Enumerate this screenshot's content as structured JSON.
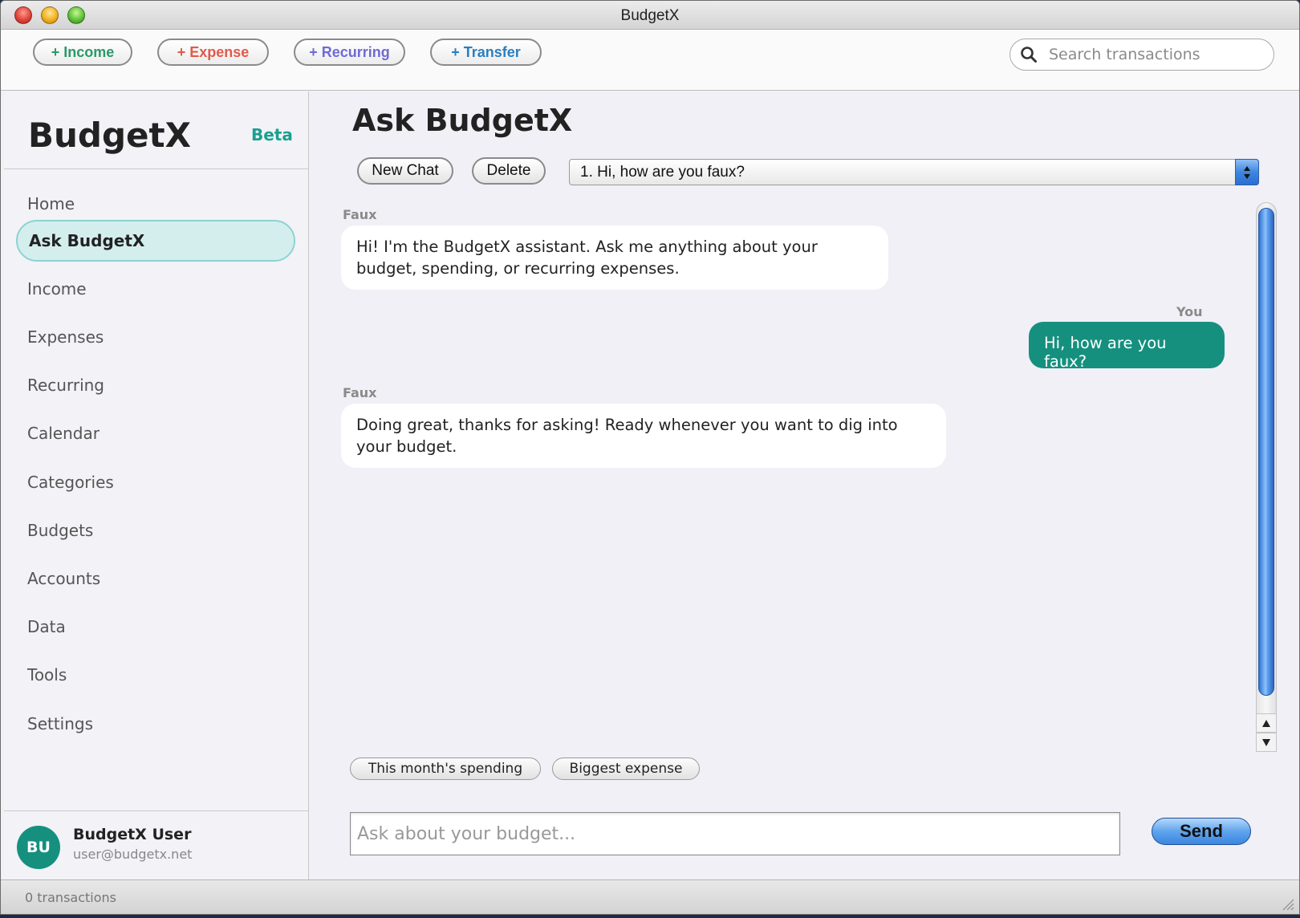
{
  "window": {
    "title": "BudgetX"
  },
  "toolbar": {
    "income_label": "+ Income",
    "expense_label": "+ Expense",
    "recurring_label": "+ Recurring",
    "transfer_label": "+ Transfer",
    "search_placeholder": "Search transactions"
  },
  "sidebar": {
    "brand": "BudgetX",
    "badge": "Beta",
    "items": [
      {
        "label": "Home"
      },
      {
        "label": "Ask BudgetX"
      },
      {
        "label": "Income"
      },
      {
        "label": "Expenses"
      },
      {
        "label": "Recurring"
      },
      {
        "label": "Calendar"
      },
      {
        "label": "Categories"
      },
      {
        "label": "Budgets"
      },
      {
        "label": "Accounts"
      },
      {
        "label": "Data"
      },
      {
        "label": "Tools"
      },
      {
        "label": "Settings"
      }
    ],
    "active_item": "Ask BudgetX",
    "user": {
      "initials": "BU",
      "name": "BudgetX User",
      "email": "user@budgetx.net"
    }
  },
  "main": {
    "title": "Ask BudgetX",
    "new_chat_label": "New Chat",
    "delete_label": "Delete",
    "conversation_selected": "1. Hi, how are you faux?",
    "messages": [
      {
        "sender": "Faux",
        "text": "Hi! I'm the BudgetX assistant. Ask me anything about your budget, spending, or recurring expenses."
      },
      {
        "sender": "You",
        "text": "Hi, how are you faux?"
      },
      {
        "sender": "Faux",
        "text": "Doing great, thanks for asking! Ready whenever you want to dig into your budget."
      }
    ],
    "suggestions": [
      "This month's spending",
      "Biggest expense"
    ],
    "input_placeholder": "Ask about your budget...",
    "send_label": "Send"
  },
  "status": {
    "text": "0 transactions"
  },
  "colors": {
    "accent": "#15907f",
    "income": "#2a9a67",
    "expense": "#e05a4a",
    "recurring": "#6e6ad6",
    "transfer": "#2a7fbf",
    "beta": "#1aa08f"
  }
}
